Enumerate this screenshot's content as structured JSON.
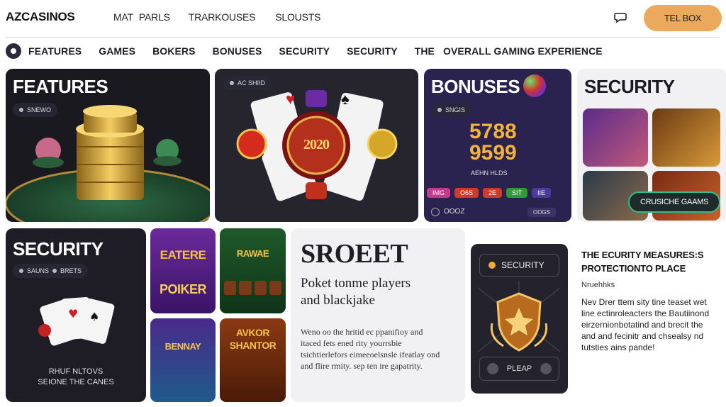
{
  "header": {
    "logo": "AZCASINOS",
    "nav": [
      "MAT",
      "PARLS",
      "TRARKOUSES",
      "SLOUSTS"
    ],
    "cta_label": "TEL BOX"
  },
  "subnav": {
    "items": [
      "FEATURES",
      "GAMES",
      "BOKERS",
      "BONUSES",
      "SECURITY",
      "SECURITY",
      "THE",
      "OVERALL GAMING EXPERIENCE"
    ]
  },
  "cards": {
    "features": {
      "title": "FEATURES",
      "pill": "SNEWO"
    },
    "cards_game": {
      "pill": "AC SHIID",
      "center_text": "2020"
    },
    "bonuses": {
      "title": "BONUSES",
      "pill": "SNGIS",
      "number1": "5788",
      "number2": "9599",
      "sub_label": "AEHN HLDS",
      "chips": [
        "IMG",
        "O6S",
        "2E",
        "SIT",
        "IIE"
      ],
      "footer_value": "OOOZ",
      "footer_btn": "OOGS"
    },
    "security_top": {
      "title": "SECURITY",
      "casino_pill": "CRUSICHE GAAMS"
    },
    "security_left": {
      "title": "SECURITY",
      "pill_a": "SAUNS",
      "pill_b": "BRETS",
      "caption_1": "RHUF NLTOVS",
      "caption_2": "SEIONE THE CANES"
    },
    "thumbs": [
      {
        "label": "POIKER",
        "top_label": "EATERE"
      },
      {
        "label": "RAWAE",
        "top_label": ""
      },
      {
        "label": "BENNAY",
        "top_label": ""
      },
      {
        "label": "SHANTOR",
        "top_label": "AVKOR"
      }
    ],
    "article": {
      "title": "SROEET",
      "subtitle_1": "Poket tonme players",
      "subtitle_2": "and blackjake",
      "body": "Weno oo the hritid ec ppanifioy and itaced fets ened rity yourrsbie tsichtierlefors eimeeoelsnsle ifeatlay ond and flire rmity. sep ten ire gapatrity."
    },
    "security_panel": {
      "head": "SECURITY",
      "bottom": "PLEAP"
    },
    "security_text": {
      "title": "THE ECURITY MEASURES:S PROTECTIONTO PLACE",
      "sub": "Nruehhks",
      "body": "Nev Drer ttem sity tine teaset wet line ectinroleacters the Bautiinond eirzernionbotatind and brecit the and and fecinitr and chsealsy nd tutsties ains pande!"
    }
  },
  "colors": {
    "accent": "#eba95d",
    "dark": "#1c1b25",
    "green": "#2fbf8c",
    "gold": "#f3b23b"
  }
}
